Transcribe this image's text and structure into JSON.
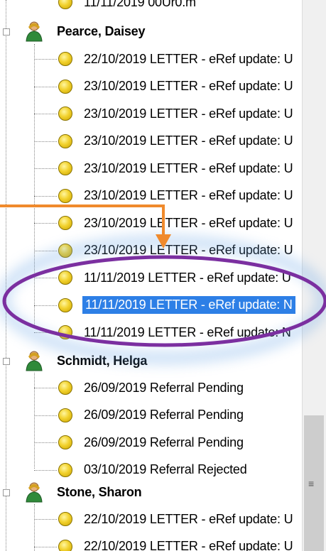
{
  "tree": {
    "top_partial": "11/11/2019 00Ur0.m",
    "patients": [
      {
        "name": "Pearce, Daisey",
        "items": [
          "22/10/2019  LETTER - eRef update: U",
          "23/10/2019  LETTER - eRef update: U",
          "23/10/2019  LETTER - eRef update: U",
          "23/10/2019  LETTER - eRef update: U",
          "23/10/2019  LETTER - eRef update: U",
          "23/10/2019  LETTER - eRef update: U",
          "23/10/2019  LETTER - eRef update: U",
          "23/10/2019  LETTER - eRef update: U",
          "11/11/2019  LETTER - eRef update: U",
          "11/11/2019  LETTER - eRef update: N",
          "11/11/2019  LETTER - eRef update: N"
        ]
      },
      {
        "name": "Schmidt, Helga",
        "items": [
          "26/09/2019  Referral Pending",
          "26/09/2019  Referral Pending",
          "26/09/2019  Referral Pending",
          "03/10/2019  Referral Rejected"
        ]
      },
      {
        "name": "Stone, Sharon",
        "items": [
          "22/10/2019  LETTER - eRef update: U",
          "22/10/2019  LETTER - eRef update: U"
        ]
      }
    ]
  },
  "colors": {
    "selection": "#2d7fe6",
    "annotation_arrow": "#f08a2c",
    "annotation_ellipse": "#7b2fa0",
    "glow": "#6aa6e6"
  },
  "icons": {
    "status": "yellow-circle-icon",
    "patient": "person-icon",
    "scroll_grip": "scroll-grip-icon"
  },
  "scrollbar": {
    "grip": "≡"
  }
}
